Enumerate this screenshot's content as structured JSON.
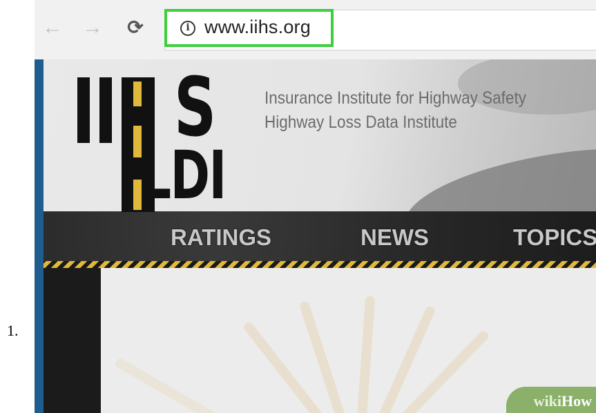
{
  "step_number": "1.",
  "browser": {
    "back_icon": "back-arrow-icon",
    "forward_icon": "forward-arrow-icon",
    "reload_icon": "reload-icon",
    "url": "www.iihs.org",
    "highlight_color": "#3ccf3c"
  },
  "site": {
    "logo_top": "IIHS",
    "logo_bottom": "HLDI",
    "org_name_1": "Insurance Institute for Highway Safety",
    "org_name_2": "Highway Loss Data Institute",
    "nav": [
      {
        "label": "RATINGS"
      },
      {
        "label": "NEWS"
      },
      {
        "label": "TOPICS"
      }
    ],
    "accent_color": "#e0b93a",
    "stripe_color": "#1f5d8e"
  },
  "watermark": {
    "text_1": "wiki",
    "text_2": "How"
  }
}
